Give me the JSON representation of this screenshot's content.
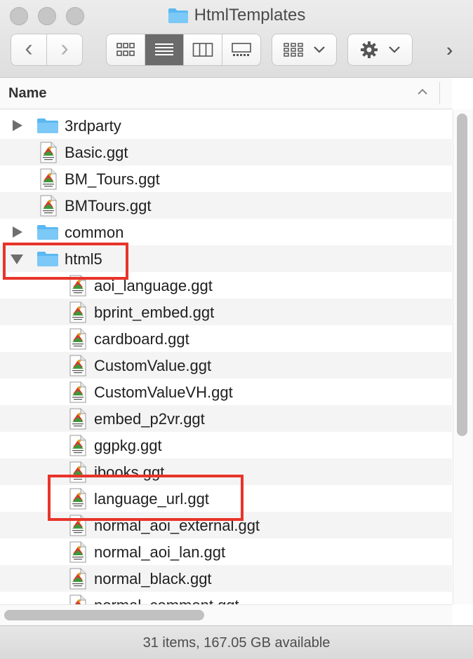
{
  "window": {
    "title": "HtmlTemplates"
  },
  "toolbar": {
    "view_mode": "list",
    "colors": {
      "active_segment": "#6b6b6b",
      "highlight": "#e8342a",
      "folder": "#5ab8f2"
    }
  },
  "column": {
    "name_label": "Name",
    "sort_indicator": "^"
  },
  "rows": [
    {
      "label": "3rdparty",
      "kind": "folder",
      "depth": 0,
      "disclosure": "closed"
    },
    {
      "label": "Basic.ggt",
      "kind": "file",
      "depth": 0
    },
    {
      "label": "BM_Tours.ggt",
      "kind": "file",
      "depth": 0
    },
    {
      "label": "BMTours.ggt",
      "kind": "file",
      "depth": 0
    },
    {
      "label": "common",
      "kind": "folder",
      "depth": 0,
      "disclosure": "closed"
    },
    {
      "label": "html5",
      "kind": "folder",
      "depth": 0,
      "disclosure": "open"
    },
    {
      "label": "aoi_language.ggt",
      "kind": "file",
      "depth": 1
    },
    {
      "label": "bprint_embed.ggt",
      "kind": "file",
      "depth": 1
    },
    {
      "label": "cardboard.ggt",
      "kind": "file",
      "depth": 1
    },
    {
      "label": "CustomValue.ggt",
      "kind": "file",
      "depth": 1
    },
    {
      "label": "CustomValueVH.ggt",
      "kind": "file",
      "depth": 1
    },
    {
      "label": "embed_p2vr.ggt",
      "kind": "file",
      "depth": 1
    },
    {
      "label": "ggpkg.ggt",
      "kind": "file",
      "depth": 1
    },
    {
      "label": "ibooks.ggt",
      "kind": "file",
      "depth": 1
    },
    {
      "label": "language_url.ggt",
      "kind": "file",
      "depth": 1
    },
    {
      "label": "normal_aoi_external.ggt",
      "kind": "file",
      "depth": 1
    },
    {
      "label": "normal_aoi_lan.ggt",
      "kind": "file",
      "depth": 1
    },
    {
      "label": "normal_black.ggt",
      "kind": "file",
      "depth": 1
    },
    {
      "label": "normal_comment.ggt",
      "kind": "file",
      "depth": 1
    }
  ],
  "status": {
    "text": "31 items, 167.05 GB available"
  },
  "annotations": {
    "highlighted_items": [
      "html5",
      "language_url.ggt"
    ]
  }
}
